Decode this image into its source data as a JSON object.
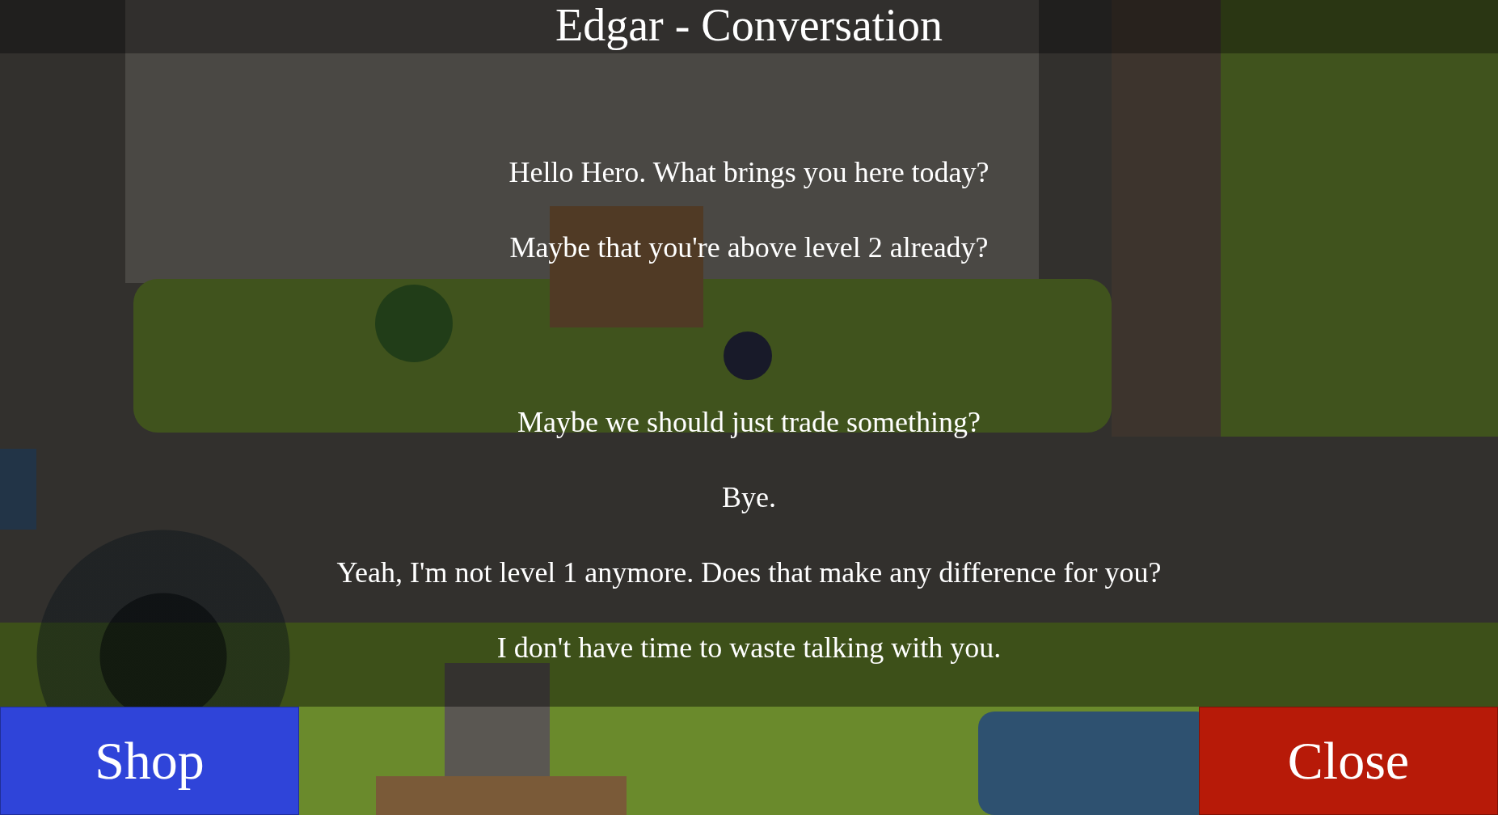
{
  "title": "Edgar - Conversation",
  "messages": [
    "Hello Hero. What brings you here today?",
    "Maybe that you're above level 2 already?"
  ],
  "options": [
    "Maybe we should just trade something?",
    "Bye.",
    "Yeah, I'm not level 1 anymore. Does that make any difference for you?",
    "I don't have time to waste talking with you."
  ],
  "buttons": [
    {
      "label": "Shop",
      "kind": "shop"
    },
    {
      "label": "Close",
      "kind": "close"
    }
  ]
}
